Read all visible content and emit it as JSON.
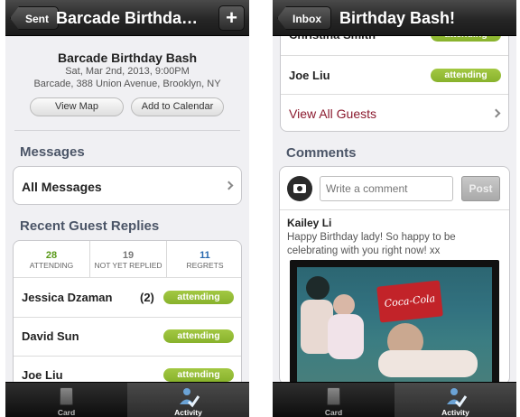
{
  "left": {
    "nav": {
      "back_label": "Sent",
      "title": "Barcade Birthday Bash",
      "add_label": "+"
    },
    "event": {
      "name": "Barcade Birthday Bash",
      "date": "Sat, Mar 2nd, 2013, 9:00PM",
      "address": "Barcade, 388 Union Avenue, Brooklyn, NY",
      "view_map_label": "View Map",
      "add_calendar_label": "Add to Calendar"
    },
    "messages": {
      "title": "Messages",
      "all_label": "All Messages"
    },
    "replies": {
      "title": "Recent Guest Replies",
      "stats": [
        {
          "num": "28",
          "label": "ATTENDING",
          "color": "#5a9a1a"
        },
        {
          "num": "19",
          "label": "NOT YET REPLIED",
          "color": "#777777"
        },
        {
          "num": "11",
          "label": "REGRETS",
          "color": "#2a6ab0"
        }
      ],
      "guests": [
        {
          "name": "Jessica Dzaman",
          "count": "(2)",
          "status": "attending"
        },
        {
          "name": "David Sun",
          "count": "",
          "status": "attending"
        },
        {
          "name": "Joe Liu",
          "count": "",
          "status": "attending"
        }
      ]
    },
    "tabs": [
      {
        "label": "Card",
        "icon": "card-icon"
      },
      {
        "label": "Activity",
        "icon": "activity-icon"
      }
    ]
  },
  "right": {
    "nav": {
      "back_label": "Inbox",
      "title": "Birthday Bash!"
    },
    "guests": [
      {
        "name": "Christina Smith",
        "status": "attending"
      },
      {
        "name": "Joe Liu",
        "status": "attending"
      }
    ],
    "view_all_label": "View All Guests",
    "comments": {
      "title": "Comments",
      "placeholder": "Write a comment",
      "post_label": "Post",
      "author": "Kailey Li",
      "text": "Happy Birthday lady! So happy to be celebrating with you right now! xx",
      "photo_sign_text": "Coca-Cola"
    },
    "tabs": [
      {
        "label": "Card",
        "icon": "card-icon"
      },
      {
        "label": "Activity",
        "icon": "activity-icon"
      }
    ]
  },
  "colors": {
    "attending_badge": "#95bd35",
    "view_all_link": "#8b1a2e",
    "section_title": "#4b5567"
  }
}
